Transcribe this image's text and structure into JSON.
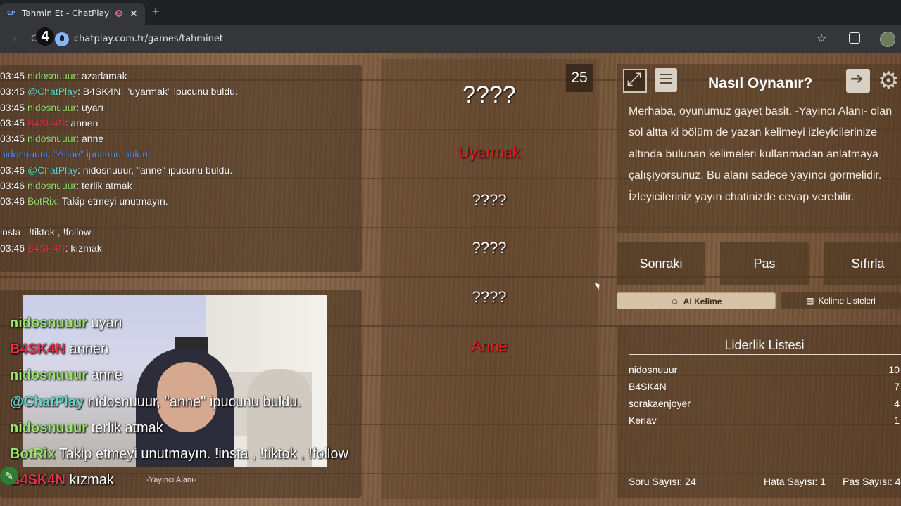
{
  "browser": {
    "tab_favicon": "CP",
    "tab_title": "Tahmin Et - ChatPlay",
    "url": "chatplay.com.tr/games/tahminet",
    "badge_number": "4"
  },
  "chat": [
    {
      "time": "03:45",
      "user": "nidosnuuur",
      "color": "green",
      "text": "azarlamak"
    },
    {
      "time": "03:45",
      "user": "@ChatPlay",
      "color": "teal",
      "text": "B4SK4N, \"uyarmak\" ipucunu buldu."
    },
    {
      "time": "03:45",
      "user": "nidosnuuur",
      "color": "green",
      "text": "uyarı"
    },
    {
      "time": "03:45",
      "user": "B4SK4N",
      "color": "red",
      "text": "annen"
    },
    {
      "time": "03:45",
      "user": "nidosnuuur",
      "color": "green",
      "text": "anne"
    },
    {
      "time": "",
      "user": "nidosnuuur, ",
      "color": "blue",
      "text": "\"Anne\" ipucunu buldu."
    },
    {
      "time": "03:46",
      "user": "@ChatPlay",
      "color": "teal",
      "text": "nidosnuuur, \"anne\" ipucunu buldu."
    },
    {
      "time": "03:46",
      "user": "nidosnuuur",
      "color": "green",
      "text": "terlik atmak"
    },
    {
      "time": "03:46",
      "user": "BotRix",
      "color": "green",
      "text": "Takip etmeyi unutmayın."
    },
    {
      "time": "",
      "user": "",
      "color": "",
      "text": "insta , !tiktok , !follow"
    },
    {
      "time": "03:46",
      "user": "B4SK4N",
      "color": "red",
      "text": "kızmak"
    }
  ],
  "overlay_chat": [
    {
      "user": "nidosnuuur",
      "color": "#9be070",
      "text": "uyarı"
    },
    {
      "user": "B4SK4N",
      "color": "#e0344a",
      "text": "annen"
    },
    {
      "user": "nidosnuuur",
      "color": "#9be070",
      "text": "anne"
    },
    {
      "user": "@ChatPlay",
      "color": "#6ad1c9",
      "text": "nidosnuuur, \"anne\" ipucunu buldu."
    },
    {
      "user": "nidosnuuur",
      "color": "#9be070",
      "text": "terlik atmak"
    },
    {
      "user": "BotRix",
      "color": "#9be070",
      "text": "Takip etmeyi unutmayın. !insta , !tiktok , !follow"
    },
    {
      "user": "B4SK4N",
      "color": "#e0344a",
      "text": "kızmak"
    }
  ],
  "streamer_area_label": "-Yayıncı Alanı-",
  "timer": "25",
  "words": [
    {
      "text": "????",
      "state": "hidden-main"
    },
    {
      "text": "Uyarmak",
      "state": "revealed"
    },
    {
      "text": "????",
      "state": "hidden"
    },
    {
      "text": "????",
      "state": "hidden"
    },
    {
      "text": "????",
      "state": "hidden"
    },
    {
      "text": "Anne",
      "state": "revealed"
    }
  ],
  "howto": {
    "title": "Nasıl Oynanır?",
    "text": "Merhaba, oyunumuz gayet basit. -Yayıncı Alanı- olan sol altta ki bölüm de yazan kelimeyi izleyicilerinize altında bulunan kelimeleri kullanmadan anlatmaya çalışıyorsunuz. Bu alanı sadece yayıncı görmelidir. İzleyicileriniz yayın chatinizde cevap verebilir."
  },
  "buttons": {
    "next": "Sonraki",
    "pass": "Pas",
    "reset": "Sıfırla",
    "ai_word": "AI Kelime",
    "word_lists": "Kelime Listeleri"
  },
  "leaderboard": {
    "title": "Liderlik Listesi",
    "rows": [
      {
        "name": "nidosnuuur",
        "score": "10"
      },
      {
        "name": "B4SK4N",
        "score": "7"
      },
      {
        "name": "sorakaenjoyer",
        "score": "4"
      },
      {
        "name": "Keriav",
        "score": "1"
      }
    ]
  },
  "stats": {
    "questions": "Soru Sayısı: 24",
    "errors": "Hata Sayısı: 1",
    "passes": "Pas Sayısı: 4"
  },
  "colors": {
    "green": "#9be070",
    "teal": "#6ad1c9",
    "red": "#e0344a",
    "blue": "#5b8dea",
    "revealed_word": "#e62020"
  }
}
